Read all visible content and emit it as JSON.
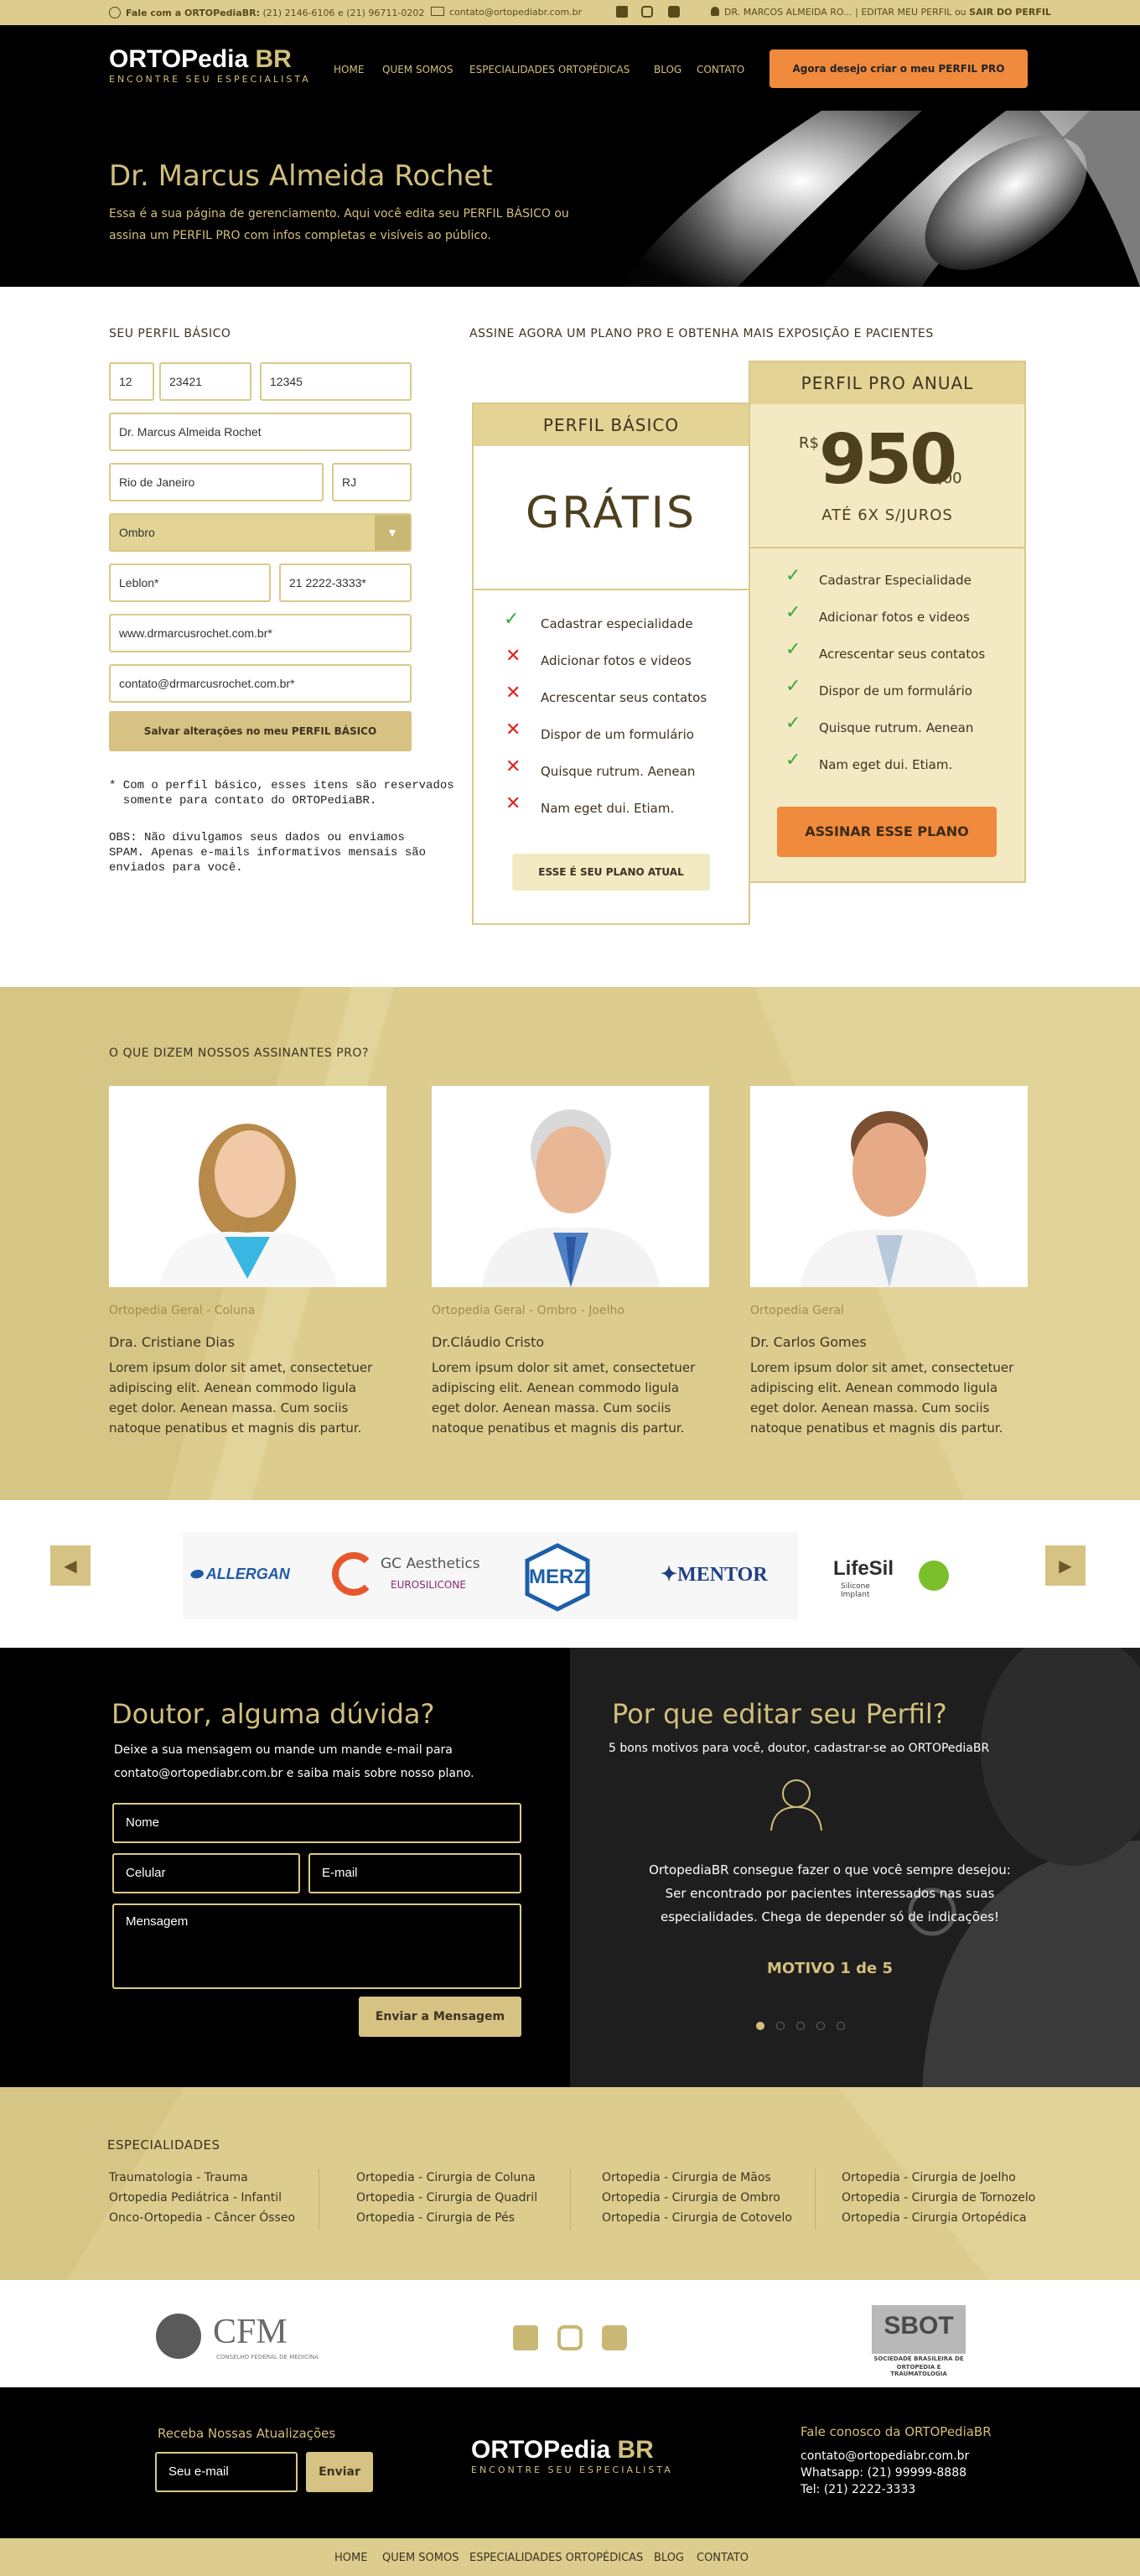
{
  "topbar": {
    "phone_label": "Fale com a ORTOPediaBR:",
    "phone_numbers": "(21) 2146-6106 e (21) 96711-0202",
    "email": "contato@ortopediabr.com.br",
    "user": "DR. MARCOS ALMEIDA RO...",
    "edit_link": "EDITAR MEU PERFIL",
    "sep": "ou",
    "logout_link": "SAIR DO PERFIL"
  },
  "nav": {
    "logo_main": "ORTOPedia",
    "logo_br": "BR",
    "logo_sub": "ENCONTRE SEU ESPECIALISTA",
    "links": [
      "HOME",
      "QUEM SOMOS",
      "ESPECIALIDADES ORTOPÉDICAS",
      "BLOG",
      "CONTATO"
    ],
    "cta_prefix": "Agora desejo criar o meu",
    "cta_bold": "PERFIL PRO"
  },
  "hero": {
    "title": "Dr. Marcus Almeida Rochet",
    "text": "Essa é a sua página de gerenciamento. Aqui você edita seu PERFIL BÁSICO ou assina um PERFIL PRO com infos completas e visíveis ao público."
  },
  "profile_form": {
    "title": "SEU PERFIL BÁSICO",
    "field_a": "12",
    "field_b": "23421",
    "field_c": "12345",
    "name": "Dr. Marcus Almeida Rochet",
    "city": "Rio de Janeiro",
    "state": "RJ",
    "specialty": "Ombro",
    "neighborhood": "Leblon*",
    "phone": "21 2222-3333*",
    "website": "www.drmarcusrochet.com.br*",
    "email": "contato@drmarcusrochet.com.br*",
    "save_prefix": "Salvar alterações no meu",
    "save_bold": "PERFIL BÁSICO",
    "note1": "* Com o perfil básico, esses itens são reservados\n  somente para contato do ORTOPediaBR.",
    "note2": "OBS: Não divulgamos seus dados ou enviamos\nSPAM. Apenas e-mails informativos mensais são\nenviados para você."
  },
  "plans": {
    "heading": "ASSINE AGORA UM PLANO PRO E OBTENHA MAIS EXPOSIÇÃO E PACIENTES",
    "basic": {
      "title": "PERFIL BÁSICO",
      "price": "GRÁTIS",
      "features": [
        {
          "label": "Cadastrar especialidade",
          "included": true
        },
        {
          "label": "Adicionar fotos e videos",
          "included": false
        },
        {
          "label": "Acrescentar seus contatos",
          "included": false
        },
        {
          "label": "Dispor de um formulário",
          "included": false
        },
        {
          "label": "Quisque rutrum. Aenean",
          "included": false
        },
        {
          "label": "Nam eget dui. Etiam.",
          "included": false
        }
      ],
      "button": "ESSE É SEU PLANO ATUAL"
    },
    "pro": {
      "title": "PERFIL PRO ANUAL",
      "currency": "R$",
      "price": "950",
      "cents": ",00",
      "installments": "ATÉ 6X S/JUROS",
      "features": [
        {
          "label": "Cadastrar  Especialidade",
          "included": true
        },
        {
          "label": "Adicionar fotos e videos",
          "included": true
        },
        {
          "label": "Acrescentar seus contatos",
          "included": true
        },
        {
          "label": "Dispor de um formulário",
          "included": true
        },
        {
          "label": "Quisque rutrum. Aenean",
          "included": true
        },
        {
          "label": "Nam eget dui. Etiam.",
          "included": true
        }
      ],
      "button": "ASSINAR ESSE PLANO"
    }
  },
  "testimonials": {
    "title": "O QUE DIZEM NOSSOS ASSINANTES PRO?",
    "items": [
      {
        "category": "Ortopedia Geral - Coluna",
        "name": "Dra. Cristiane Dias",
        "text": "Lorem ipsum dolor sit amet, consectetuer adipiscing elit. Aenean commodo ligula eget dolor. Aenean massa. Cum sociis natoque penatibus et magnis dis partur."
      },
      {
        "category": "Ortopedia Geral - Ombro - Joelho",
        "name": "Dr.Cláudio Cristo",
        "text": "Lorem ipsum dolor sit amet, consectetuer adipiscing elit. Aenean commodo ligula eget dolor. Aenean massa. Cum sociis natoque penatibus et magnis dis partur."
      },
      {
        "category": "Ortopedia Geral",
        "name": "Dr. Carlos Gomes",
        "text": "Lorem ipsum dolor sit amet, consectetuer adipiscing elit. Aenean commodo ligula eget dolor. Aenean massa. Cum sociis natoque penatibus et magnis dis partur."
      }
    ]
  },
  "brands": {
    "prev": "◀",
    "next": "▶",
    "logos": [
      "ALLERGAN",
      "GC Aesthetics",
      "EUROSILICONE",
      "MERZ",
      "MENTOR",
      "LifeSil",
      "Silicone Implant"
    ]
  },
  "contact": {
    "title": "Doutor, alguma dúvida?",
    "text1": "Deixe a sua mensagem ou mande um mande e-mail para",
    "text2": "contato@ortopediabr.com.br e saiba mais sobre nosso plano.",
    "name_ph": "Nome",
    "phone_ph": "Celular",
    "email_ph": "E-mail",
    "message_ph": "Mensagem",
    "send": "Enviar a Mensagem"
  },
  "why": {
    "title": "Por que  editar seu Perfil?",
    "subtitle": "5 bons motivos para você, doutor, cadastrar-se ao ORTOPediaBR",
    "text1": "OrtopediaBR consegue fazer o que você sempre desejou:",
    "text2": "Ser encontrado por pacientes interessados nas suas",
    "text3": "especialidades. Chega de depender só de indicações!",
    "counter": "MOTIVO 1 de 5",
    "active_dot": 1,
    "dots": 5
  },
  "specialties": {
    "title": "ESPECIALIDADES",
    "columns": [
      [
        "Traumatologia -  Trauma",
        "Ortopedia Pediátrica - Infantil",
        "Onco-Ortopedia - Câncer Ósseo"
      ],
      [
        "Ortopedia - Cirurgia de Coluna",
        "Ortopedia - Cirurgia de Quadril",
        "Ortopedia - Cirurgia de Pés"
      ],
      [
        "Ortopedia - Cirurgia de Mãos",
        "Ortopedia - Cirurgia de Ombro",
        "Ortopedia - Cirurgia de Cotovelo"
      ],
      [
        "Ortopedia - Cirurgia de Joelho",
        "Ortopedia - Cirurgia de Tornozelo",
        "Ortopedia - Cirurgia Ortopédica"
      ]
    ]
  },
  "social": {
    "cfm": "CFM",
    "cfm_sub": "CONSELHO FEDERAL DE MEDICINA",
    "sbot": "SBOT",
    "sbot_sub1": "SOCIEDADE BRASILEIRA DE",
    "sbot_sub2": "ORTOPEDIA E TRAUMATOLOGIA"
  },
  "footer": {
    "newsletter_title": "Receba Nossas Atualizações",
    "email_ph": "Seu e-mail",
    "send": "Enviar",
    "logo_main": "ORTOPedia",
    "logo_br": "BR",
    "logo_sub": "ENCONTRE SEU ESPECIALISTA",
    "contact_title": "Fale conosco da ORTOPediaBR",
    "email": "contato@ortopediabr.com.br",
    "whatsapp": "Whatsapp: (21) 99999-8888",
    "tel": "Tel: (21) 2222-3333",
    "links": [
      "HOME",
      "QUEM SOMOS",
      "ESPECIALIDADES ORTOPÉDICAS",
      "BLOG",
      "CONTATO"
    ]
  },
  "colors": {
    "gold": "#d2bf7c",
    "sand": "#dccd8f",
    "orange": "#f08a3c",
    "black": "#000000",
    "check": "#3aa83c",
    "cross": "#e0231c"
  }
}
